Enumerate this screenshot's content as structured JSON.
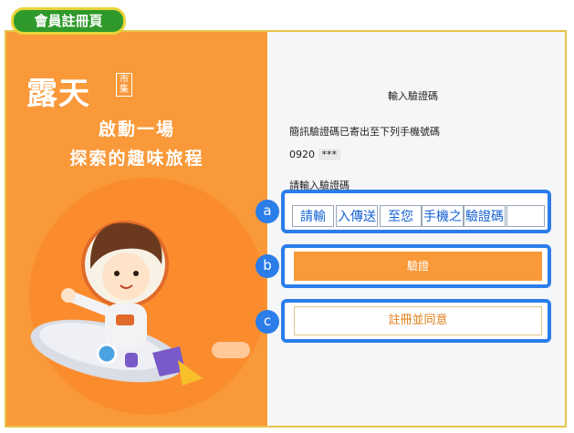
{
  "page_title": "會員註冊頁",
  "brand": {
    "logo_text": "露天",
    "logo_sub": "市集"
  },
  "hero": {
    "slogan_line1": "啟動一場",
    "slogan_line2": "探索的趣味旅程"
  },
  "form": {
    "heading": "輸入驗證碼",
    "sms_notice": "簡訊驗證碼已寄出至下列手機號碼",
    "phone_prefix": "0920",
    "phone_masked": "***",
    "code_label": "請輸入驗證碼",
    "code_cells": [
      "請輸",
      "入傳送",
      "至您",
      "手機之",
      "驗證碼",
      ""
    ],
    "verify_label": "驗證",
    "register_label": "註冊並同意"
  },
  "markers": {
    "a": "a",
    "b": "b",
    "c": "c"
  },
  "colors": {
    "accent_orange": "#f9993a",
    "marker_blue": "#2b7de9",
    "badge_green": "#2f9a2b"
  }
}
